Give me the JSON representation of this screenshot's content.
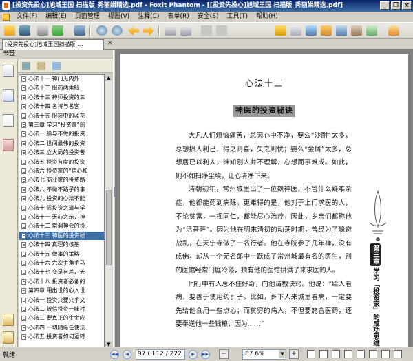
{
  "window": {
    "title": "[投资先投心]旭域王国 扫描版_秀丽娟精选.pdf - Foxit Phantom - [[投资先投心]旭域王国 扫描版_秀丽娟精选.pdf]",
    "minimize": "_",
    "restore": "❐",
    "close": "×"
  },
  "menu": {
    "items": [
      "文件(F)",
      "编辑(E)",
      "页面管理",
      "视图(V)",
      "注释(C)",
      "表单(R)",
      "安全(S)",
      "工具(T)",
      "帮助(H)"
    ]
  },
  "tabs": {
    "active": "[投资先投心]旭域王国扫描版_...",
    "close": "×"
  },
  "sidebar": {
    "header": "书签",
    "bookmarks": [
      "心法十一  神门无内外",
      "心法十二  服药两乘船",
      "心法十三  神师投资的三",
      "心法十四  名将与名客",
      "心法十五  服装中的蓝花",
      "第三章  学习“投资家”的",
      "心法一  操与不做的投资",
      "心法二  世间最伟的投资",
      "心法三  立大局的投资者",
      "心法五  投资有度的投资",
      "心法六  投资家的“信心和",
      "心法七  商业家的投资路",
      "心法八  不做不路子的事",
      "心法九  投资的心法不能",
      "心法十  俗投资之道与学",
      "心法十一  无心之示，神",
      "心法十二  常洞神会的投",
      "心法十三  神医的投资秘",
      "心法十四  真理的核基",
      "心法十五  做事的策略",
      "心法十六  六次主角手马",
      "心法十七  变是有差，天",
      "心法十八  投资者必备的",
      "第四章  用出世的心入世",
      "心法一  投资只要只手又",
      "心法二  被信投资一味衬",
      "心法三  要真正的生金应",
      "心法四  一切随缘任使法",
      "心法五  投资者如何运转"
    ],
    "selected_index": 17
  },
  "document": {
    "heading": "心法十三",
    "subheading": "神医的投资秘诀",
    "paragraphs": [
      "大凡人们烦恼痛苦，总因心中不净，要么“沙耐”太多，总想损人利己，得之则喜，失之则忧；要么“金屑”太多，总想居已以利人，谁知别人并不理解，心想而事难成。如此，则不如扫净尘埃，让心清净下来。",
      "清朝初年，常州城里出了一位魏神医，不管什么疑难杂症，他都能药到病除。更难得的是，他对于上门求医的人，不论贫富，一视同仁，都能尽心治疗，因此，乡亲们都称他为“活菩萨”。因为他在明末清初的动荡时期，曾经为了躲避战乱，在天宁寺做了一名行者。他在寺院参了几年禅，没有成佛，却从一个无名郎中一跃成了常州城最有名的医生，别的医馆经常门庭冷落，独有他的医馆拼满了来求医的人。",
      "同行中有人总不住好奇，向他请教诀窍。他说：“给人看病，要善于使用药引子。比如，乡下人来城里看病，一定要先给他食用一些点心；而贫穷的病人，不但要施舍医药，还要奉送他一些钱粮，因为……”"
    ],
    "margin_badge": "第三章",
    "margin_text": "学习「投资家」的成功思维"
  },
  "status": {
    "text": "就绪",
    "page_field": "97  ( 112 / 222 )",
    "zoom": "87.6%",
    "zoom_out": "−",
    "zoom_in": "+"
  }
}
